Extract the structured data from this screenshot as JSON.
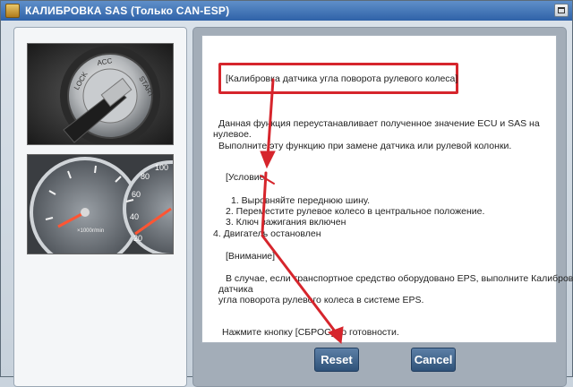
{
  "window": {
    "title": "КАЛИБРОВКА SAS (Только CAN-ESP)"
  },
  "content": {
    "heading": "[Калибровка датчика угла поворота рулевого колеса]",
    "description": [
      "Данная функция переустанавливает полученное значение ECU и SAS на",
      "нулевое.",
      "Выполните эту функцию при замене датчика или рулевой колонки."
    ],
    "condition_title": "[Условие]",
    "conditions": [
      "1. Выровняйте переднюю шину.",
      "2. Переместите рулевое колесо в центральное положение.",
      "3. Ключ зажигания включен",
      "4. Двигатель остановлен"
    ],
    "attention_title": "[Внимание]",
    "attention": [
      "В случае, если транспортное средство оборудовано EPS, выполните Калибровку",
      "датчика",
      "угла поворота рулевого колеса в системе EPS."
    ],
    "final_note": "Нажмите кнопку [СБРОС] по готовности."
  },
  "buttons": {
    "reset": "Reset",
    "cancel": "Cancel"
  },
  "images": {
    "ignition_key_marks": [
      "LOCK",
      "ACC",
      "START"
    ],
    "gauge_labels": [
      "×1000r/min",
      "20",
      "40",
      "60",
      "80",
      "100"
    ]
  },
  "colors": {
    "annotation_red": "#d6252c",
    "button_blue": "#2f5279",
    "titlebar_blue": "#2f62a8"
  }
}
